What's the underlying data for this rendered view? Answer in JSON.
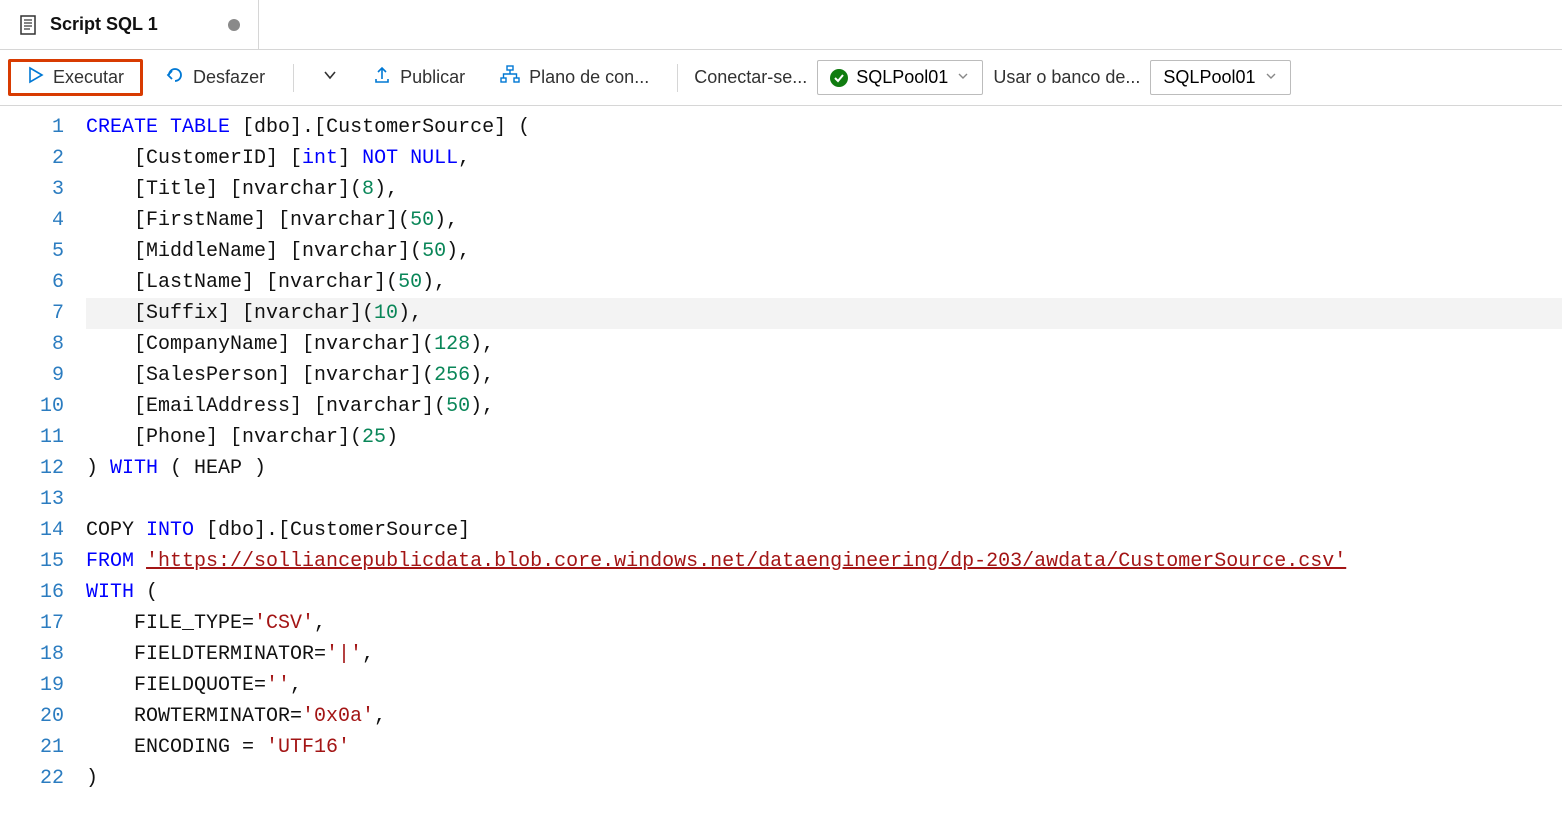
{
  "tab": {
    "title": "Script SQL 1",
    "dirty": true
  },
  "toolbar": {
    "run_label": "Executar",
    "undo_label": "Desfazer",
    "publish_label": "Publicar",
    "plan_label": "Plano de con...",
    "connect_label": "Conectar-se...",
    "connect_value": "SQLPool01",
    "db_label": "Usar o banco de...",
    "db_value": "SQLPool01"
  },
  "code": {
    "line_count": 22,
    "lines": [
      [
        [
          "kw",
          "CREATE"
        ],
        [
          "txt",
          " "
        ],
        [
          "kw",
          "TABLE"
        ],
        [
          "txt",
          " [dbo].[CustomerSource] ("
        ]
      ],
      [
        [
          "txt",
          "    [CustomerID] ["
        ],
        [
          "kw",
          "int"
        ],
        [
          "txt",
          "] "
        ],
        [
          "kw",
          "NOT"
        ],
        [
          "txt",
          " "
        ],
        [
          "kw",
          "NULL"
        ],
        [
          "txt",
          ","
        ]
      ],
      [
        [
          "txt",
          "    [Title] [nvarchar]("
        ],
        [
          "num",
          "8"
        ],
        [
          "txt",
          "),"
        ]
      ],
      [
        [
          "txt",
          "    [FirstName] [nvarchar]("
        ],
        [
          "num",
          "50"
        ],
        [
          "txt",
          "),"
        ]
      ],
      [
        [
          "txt",
          "    [MiddleName] [nvarchar]("
        ],
        [
          "num",
          "50"
        ],
        [
          "txt",
          "),"
        ]
      ],
      [
        [
          "txt",
          "    [LastName] [nvarchar]("
        ],
        [
          "num",
          "50"
        ],
        [
          "txt",
          "),"
        ]
      ],
      [
        [
          "txt",
          "    [Suffix] [nvarchar]("
        ],
        [
          "num",
          "10"
        ],
        [
          "txt",
          "),"
        ]
      ],
      [
        [
          "txt",
          "    [CompanyName] [nvarchar]("
        ],
        [
          "num",
          "128"
        ],
        [
          "txt",
          "),"
        ]
      ],
      [
        [
          "txt",
          "    [SalesPerson] [nvarchar]("
        ],
        [
          "num",
          "256"
        ],
        [
          "txt",
          "),"
        ]
      ],
      [
        [
          "txt",
          "    [EmailAddress] [nvarchar]("
        ],
        [
          "num",
          "50"
        ],
        [
          "txt",
          "),"
        ]
      ],
      [
        [
          "txt",
          "    [Phone] [nvarchar]("
        ],
        [
          "num",
          "25"
        ],
        [
          "txt",
          ")"
        ]
      ],
      [
        [
          "txt",
          ") "
        ],
        [
          "kw",
          "WITH"
        ],
        [
          "txt",
          " ( HEAP )"
        ]
      ],
      [
        [
          "txt",
          ""
        ]
      ],
      [
        [
          "txt",
          "COPY "
        ],
        [
          "kw",
          "INTO"
        ],
        [
          "txt",
          " [dbo].[CustomerSource]"
        ]
      ],
      [
        [
          "kw",
          "FROM"
        ],
        [
          "txt",
          " "
        ],
        [
          "strurl",
          "'https://solliancepublicdata.blob.core.windows.net/dataengineering/dp-203/awdata/CustomerSource.csv'"
        ]
      ],
      [
        [
          "kw",
          "WITH"
        ],
        [
          "txt",
          " ("
        ]
      ],
      [
        [
          "txt",
          "    FILE_TYPE="
        ],
        [
          "str",
          "'CSV'"
        ],
        [
          "txt",
          ","
        ]
      ],
      [
        [
          "txt",
          "    FIELDTERMINATOR="
        ],
        [
          "str",
          "'|'"
        ],
        [
          "txt",
          ","
        ]
      ],
      [
        [
          "txt",
          "    FIELDQUOTE="
        ],
        [
          "str",
          "''"
        ],
        [
          "txt",
          ","
        ]
      ],
      [
        [
          "txt",
          "    ROWTERMINATOR="
        ],
        [
          "str",
          "'0x0a'"
        ],
        [
          "txt",
          ","
        ]
      ],
      [
        [
          "txt",
          "    ENCODING = "
        ],
        [
          "str",
          "'UTF16'"
        ]
      ],
      [
        [
          "txt",
          ")"
        ]
      ]
    ],
    "highlight_line": 7
  }
}
